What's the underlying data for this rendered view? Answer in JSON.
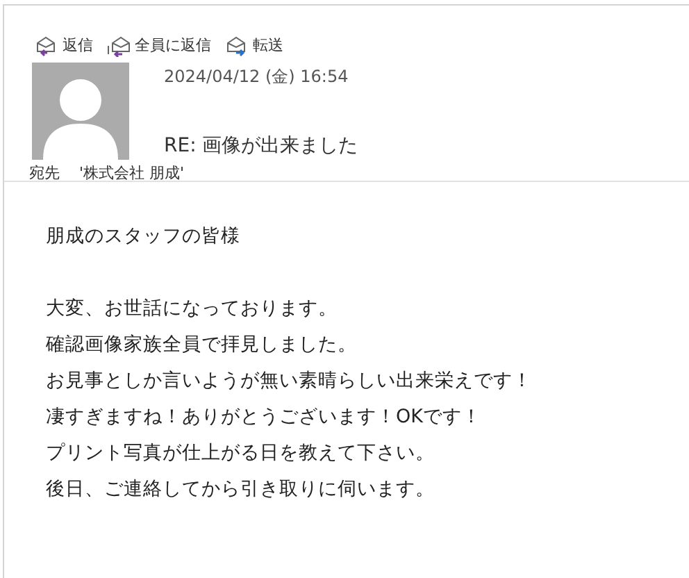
{
  "actions": [
    {
      "kind": "reply",
      "label": "返信"
    },
    {
      "kind": "reply_all",
      "label": "全員に返信"
    },
    {
      "kind": "forward",
      "label": "転送"
    }
  ],
  "message": {
    "date": "2024/04/12 (金) 16:54",
    "subject": "RE: 画像が出来ました",
    "to_label": "宛先",
    "to": "'株式会社 朋成'"
  },
  "body": {
    "greeting": "朋成のスタッフの皆様",
    "lines": [
      "大変、お世話になっております。",
      "確認画像家族全員で拝見しました。",
      "お見事としか言いようが無い素晴らしい出来栄えです！",
      "凄すぎますね！ありがとうございます！OKです！",
      "プリント写真が仕上がる日を教えて下さい。",
      "後日、ご連絡してから引き取りに伺います。"
    ]
  }
}
